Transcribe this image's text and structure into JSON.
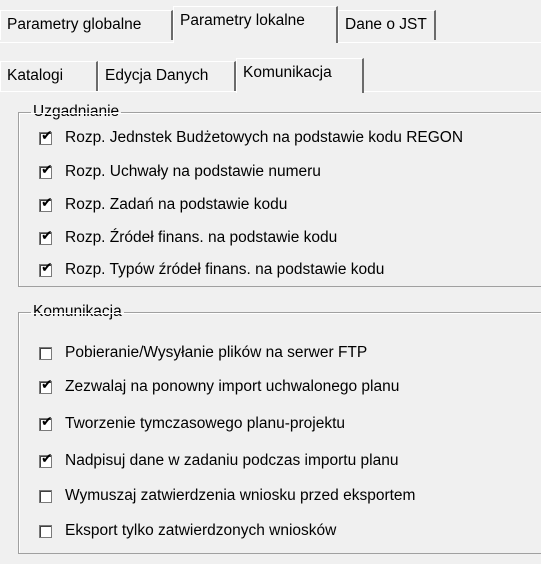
{
  "tabs_top": [
    {
      "label": "Parametry globalne",
      "active": false
    },
    {
      "label": "Parametry lokalne",
      "active": true
    },
    {
      "label": "Dane o JST",
      "active": false
    }
  ],
  "tabs_second": [
    {
      "label": "Katalogi",
      "active": false
    },
    {
      "label": "Edycja Danych",
      "active": false
    },
    {
      "label": "Komunikacja",
      "active": true
    }
  ],
  "uzgadnianie": {
    "title": "Uzgadnianie",
    "items": [
      {
        "label": "Rozp.  Jednstek Budżetowych na podstawie kodu REGON",
        "checked": true
      },
      {
        "label": "Rozp.  Uchwały na podstawie numeru",
        "checked": true
      },
      {
        "label": "Rozp.  Zadań na podstawie kodu",
        "checked": true
      },
      {
        "label": "Rozp.  Źródeł finans. na podstawie kodu",
        "checked": true
      },
      {
        "label": "Rozp.  Typów źródeł finans. na podstawie kodu",
        "checked": true
      }
    ]
  },
  "komunikacja": {
    "title": "Komunikacja",
    "items": [
      {
        "label": "Pobieranie/Wysyłanie plików na serwer FTP",
        "checked": false
      },
      {
        "label": "Zezwalaj na ponowny import uchwalonego planu",
        "checked": true
      },
      {
        "label": "Tworzenie tymczasowego planu-projektu",
        "checked": true
      },
      {
        "label": "Nadpisuj dane w zadaniu podczas importu planu",
        "checked": true
      },
      {
        "label": "Wymuszaj zatwierdzenia wniosku przed eksportem",
        "checked": false
      },
      {
        "label": "Eksport tylko zatwierdzonych wniosków",
        "checked": false
      }
    ]
  },
  "checkmark_glyph": "✔"
}
